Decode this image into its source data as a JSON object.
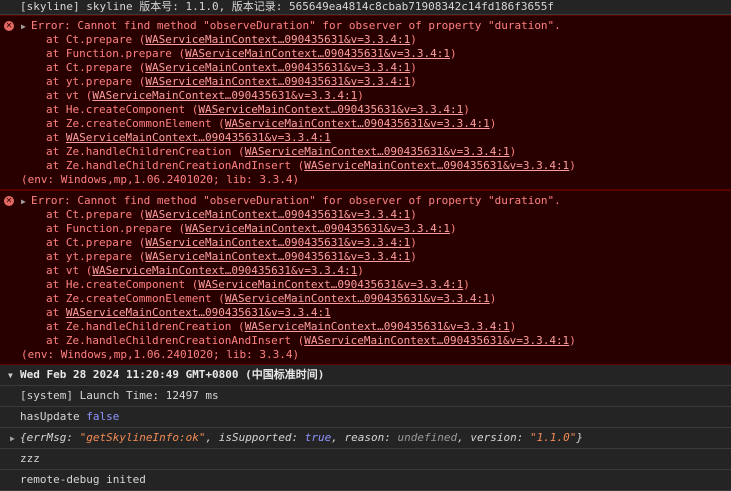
{
  "top_log": "[skyline] skyline 版本号: 1.1.0, 版本记录: 565649ea4814c8cbab71908342c14fd186f3655f",
  "errors": [
    {
      "message": "Error: Cannot find method \"observeDuration\" for observer of property \"duration\".",
      "frames": [
        {
          "pre": "at Ct.prepare (",
          "link": "WAServiceMainContext…090435631&v=3.3.4:1",
          "post": ")"
        },
        {
          "pre": "at Function.prepare (",
          "link": "WAServiceMainContext…090435631&v=3.3.4:1",
          "post": ")"
        },
        {
          "pre": "at Ct.prepare (",
          "link": "WAServiceMainContext…090435631&v=3.3.4:1",
          "post": ")"
        },
        {
          "pre": "at yt.prepare (",
          "link": "WAServiceMainContext…090435631&v=3.3.4:1",
          "post": ")"
        },
        {
          "pre": "at vt (",
          "link": "WAServiceMainContext…090435631&v=3.3.4:1",
          "post": ")"
        },
        {
          "pre": "at He.createComponent (",
          "link": "WAServiceMainContext…090435631&v=3.3.4:1",
          "post": ")"
        },
        {
          "pre": "at Ze.createCommonElement (",
          "link": "WAServiceMainContext…090435631&v=3.3.4:1",
          "post": ")"
        },
        {
          "pre": "at ",
          "link": "WAServiceMainContext…090435631&v=3.3.4:1",
          "post": ""
        },
        {
          "pre": "at Ze.handleChildrenCreation (",
          "link": "WAServiceMainContext…090435631&v=3.3.4:1",
          "post": ")"
        },
        {
          "pre": "at Ze.handleChildrenCreationAndInsert (",
          "link": "WAServiceMainContext…090435631&v=3.3.4:1",
          "post": ")"
        }
      ],
      "env": "(env: Windows,mp,1.06.2401020; lib: 3.3.4)"
    },
    {
      "message": "Error: Cannot find method \"observeDuration\" for observer of property \"duration\".",
      "frames": [
        {
          "pre": "at Ct.prepare (",
          "link": "WAServiceMainContext…090435631&v=3.3.4:1",
          "post": ")"
        },
        {
          "pre": "at Function.prepare (",
          "link": "WAServiceMainContext…090435631&v=3.3.4:1",
          "post": ")"
        },
        {
          "pre": "at Ct.prepare (",
          "link": "WAServiceMainContext…090435631&v=3.3.4:1",
          "post": ")"
        },
        {
          "pre": "at yt.prepare (",
          "link": "WAServiceMainContext…090435631&v=3.3.4:1",
          "post": ")"
        },
        {
          "pre": "at vt (",
          "link": "WAServiceMainContext…090435631&v=3.3.4:1",
          "post": ")"
        },
        {
          "pre": "at He.createComponent (",
          "link": "WAServiceMainContext…090435631&v=3.3.4:1",
          "post": ")"
        },
        {
          "pre": "at Ze.createCommonElement (",
          "link": "WAServiceMainContext…090435631&v=3.3.4:1",
          "post": ")"
        },
        {
          "pre": "at ",
          "link": "WAServiceMainContext…090435631&v=3.3.4:1",
          "post": ""
        },
        {
          "pre": "at Ze.handleChildrenCreation (",
          "link": "WAServiceMainContext…090435631&v=3.3.4:1",
          "post": ")"
        },
        {
          "pre": "at Ze.handleChildrenCreationAndInsert (",
          "link": "WAServiceMainContext…090435631&v=3.3.4:1",
          "post": ")"
        }
      ],
      "env": "(env: Windows,mp,1.06.2401020; lib: 3.3.4)"
    }
  ],
  "group": {
    "title": "Wed Feb 28 2024 11:20:49 GMT+0800 (中国标准时间)"
  },
  "messages": {
    "launch": "[system] Launch Time: 12497 ms",
    "has_update_key": "hasUpdate",
    "has_update_val": "false",
    "obj_open": "{errMsg: ",
    "obj_errmsg": "\"getSkylineInfo:ok\"",
    "obj_k2": ", isSupported: ",
    "obj_v2": "true",
    "obj_k3": ", reason: ",
    "obj_v3": "undefined",
    "obj_k4": ", version: ",
    "obj_v4": "\"1.1.0\"",
    "obj_close": "}",
    "zzz": "zzz",
    "remote": "remote-debug inited"
  },
  "icons": {
    "error": "error-icon",
    "expand": "triangle-right-icon",
    "collapse": "triangle-down-icon"
  },
  "colors": {
    "error_text": "#ff8080",
    "error_bg": "#290000",
    "boolean": "#8e95ff",
    "string": "#f28b54"
  }
}
